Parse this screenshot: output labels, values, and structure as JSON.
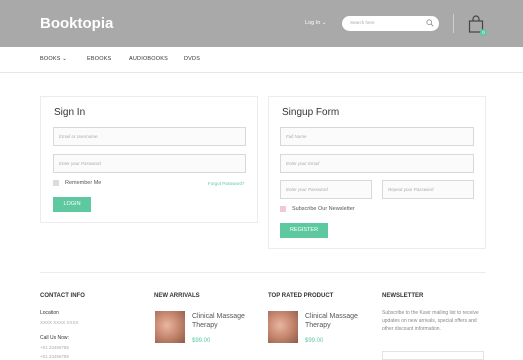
{
  "header": {
    "logo": "Booktopia",
    "login": "Log In ⌄",
    "search_placeholder": "Search here",
    "cart_count": "0"
  },
  "nav": [
    "BOOKS ⌄",
    "EBOOKS",
    "AUDIOBOOKS",
    "DVDS"
  ],
  "signin": {
    "title": "Sign In",
    "email_placeholder": "Email or Username",
    "password_placeholder": "Enter your Password",
    "remember": "Remember Me",
    "forgot": "Forgot Password?",
    "button": "LOGIN"
  },
  "signup": {
    "title": "Singup Form",
    "name_placeholder": "Full Name",
    "email_placeholder": "Enter your Email",
    "password_placeholder": "Enter your Password",
    "repeat_placeholder": "Repeat your Password",
    "newsletter": "Subscribe Our Newsletter",
    "button": "REGISTER"
  },
  "footer": {
    "contact_title": "CONTACT INFO",
    "location_label": "Location",
    "location_value": "XXXX XXXX XXXX",
    "call_label": "Call Us Now:",
    "phone1": "+01 23456789",
    "phone2": "+01 23456789",
    "new_arrivals_title": "NEW ARRIVALS",
    "top_rated_title": "TOP RATED PRODUCT",
    "newsletter_title": "NEWSLETTER",
    "newsletter_text": "Subscribe to the Kavir mailing list to receive updates on new arrivals, special offers and other discount information.",
    "products": [
      {
        "name": "Clinical Massage Therapy",
        "price": "$99.00"
      },
      {
        "name": "Clinical Massage Therapy",
        "price": "$99.00"
      }
    ]
  },
  "colors": {
    "header_bg": "#a9a9a9",
    "accent": "#5ec8a0"
  }
}
